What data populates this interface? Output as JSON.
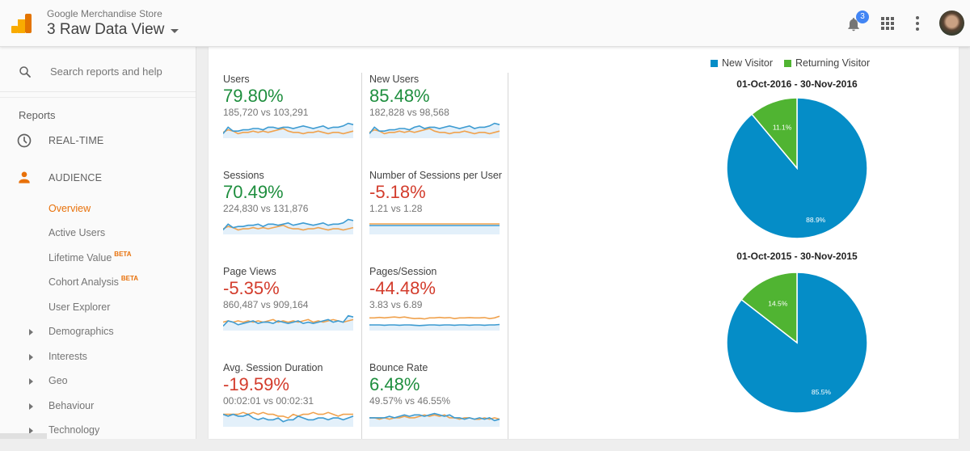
{
  "header": {
    "account": "Google Merchandise Store",
    "view": "3 Raw Data View",
    "notification_count": "3"
  },
  "sidebar": {
    "search_placeholder": "Search reports and help",
    "section_label": "Reports",
    "realtime": "REAL-TIME",
    "audience": "AUDIENCE",
    "items": [
      {
        "label": "Overview",
        "active": true
      },
      {
        "label": "Active Users"
      },
      {
        "label": "Lifetime Value",
        "badge": "BETA"
      },
      {
        "label": "Cohort Analysis",
        "badge": "BETA"
      },
      {
        "label": "User Explorer"
      },
      {
        "label": "Demographics",
        "expandable": true
      },
      {
        "label": "Interests",
        "expandable": true
      },
      {
        "label": "Geo",
        "expandable": true
      },
      {
        "label": "Behaviour",
        "expandable": true
      },
      {
        "label": "Technology",
        "expandable": true
      }
    ]
  },
  "colors": {
    "current": "#3d9bd1",
    "previous": "#f0a24e",
    "positive": "#1e8e3e",
    "negative": "#d33c2c",
    "new_visitor": "#058dc7",
    "returning_visitor": "#50b432",
    "accent": "#e8710a"
  },
  "metrics": [
    {
      "title": "Users",
      "change": "79.80%",
      "direction": "up",
      "comparison": "185,720 vs 103,291",
      "current": [
        4,
        9,
        6,
        6,
        7,
        7,
        8,
        8,
        7,
        9,
        9,
        8,
        9,
        9,
        8,
        9,
        10,
        9,
        8,
        9,
        10,
        8,
        9,
        9,
        10,
        12,
        11
      ],
      "previous": [
        5,
        7,
        6,
        4,
        5,
        5,
        6,
        5,
        6,
        5,
        6,
        7,
        8,
        6,
        5,
        5,
        4,
        5,
        5,
        6,
        5,
        4,
        5,
        5,
        4,
        5,
        6
      ]
    },
    {
      "title": "New Users",
      "change": "85.48%",
      "direction": "up",
      "comparison": "182,828 vs 98,568",
      "current": [
        4,
        9,
        6,
        6,
        7,
        7,
        8,
        8,
        7,
        9,
        10,
        8,
        9,
        9,
        8,
        9,
        10,
        9,
        8,
        9,
        10,
        8,
        9,
        9,
        10,
        12,
        11
      ],
      "previous": [
        5,
        7,
        6,
        4,
        5,
        5,
        6,
        5,
        6,
        5,
        6,
        7,
        8,
        6,
        5,
        5,
        4,
        5,
        5,
        6,
        5,
        4,
        5,
        5,
        4,
        5,
        6
      ]
    },
    {
      "title": "Sessions",
      "change": "70.49%",
      "direction": "up",
      "comparison": "224,830 vs 131,876",
      "current": [
        4,
        9,
        6,
        7,
        7,
        8,
        8,
        9,
        7,
        9,
        9,
        8,
        9,
        10,
        8,
        9,
        10,
        9,
        8,
        9,
        10,
        8,
        9,
        9,
        10,
        13,
        12
      ],
      "previous": [
        5,
        7,
        6,
        4,
        5,
        5,
        6,
        5,
        6,
        5,
        6,
        7,
        8,
        6,
        5,
        5,
        4,
        5,
        5,
        6,
        5,
        4,
        5,
        5,
        4,
        5,
        6
      ]
    },
    {
      "title": "Number of Sessions per User",
      "change": "-5.18%",
      "direction": "down",
      "comparison": "1.21 vs 1.28",
      "current": [
        10,
        10,
        10,
        10,
        10,
        10,
        10,
        10,
        10,
        10,
        10,
        10,
        10,
        10,
        10,
        10,
        10,
        10,
        10,
        10,
        10,
        10,
        10,
        10,
        10,
        10,
        10
      ],
      "previous": [
        10.3,
        10.3,
        10.3,
        10.3,
        10.3,
        10.3,
        10.3,
        10.3,
        10.3,
        10.3,
        10.3,
        10.3,
        10.3,
        10.3,
        10.3,
        10.3,
        10.3,
        10.3,
        10.3,
        10.3,
        10.3,
        10.3,
        10.3,
        10.3,
        10.3,
        10.3,
        10.3
      ]
    },
    {
      "title": "Page Views",
      "change": "-5.35%",
      "direction": "down",
      "comparison": "860,487 vs 909,164",
      "current": [
        4,
        8,
        7,
        5,
        6,
        7,
        8,
        6,
        7,
        7,
        6,
        8,
        7,
        6,
        7,
        8,
        6,
        7,
        6,
        7,
        8,
        9,
        7,
        8,
        7,
        12,
        11
      ],
      "previous": [
        7,
        8,
        7,
        8,
        7,
        8,
        7,
        8,
        7,
        8,
        9,
        7,
        8,
        7,
        8,
        7,
        8,
        9,
        7,
        8,
        7,
        8,
        9,
        8,
        7,
        8,
        9
      ]
    },
    {
      "title": "Pages/Session",
      "change": "-44.48%",
      "direction": "down",
      "comparison": "3.83 vs 6.89",
      "current": [
        5,
        5,
        5,
        4.8,
        5,
        5,
        4.8,
        5,
        5,
        4.8,
        4.6,
        4.8,
        5,
        5,
        4.8,
        5,
        5,
        4.8,
        5,
        5,
        4.8,
        5,
        5,
        4.8,
        5,
        5,
        5.2
      ],
      "previous": [
        9,
        9,
        9.3,
        9,
        9.3,
        9.5,
        9.2,
        9.5,
        9,
        8.6,
        8.8,
        8.4,
        9,
        9,
        9.3,
        9,
        9.2,
        8.6,
        9,
        9,
        9.2,
        9,
        9,
        9.2,
        8.6,
        9,
        10
      ]
    },
    {
      "title": "Avg. Session Duration",
      "change": "-19.59%",
      "direction": "down",
      "comparison": "00:02:01 vs 00:02:31",
      "current": [
        8,
        7,
        8,
        7,
        7,
        8,
        6,
        5,
        6,
        5,
        5,
        6,
        4,
        5,
        5,
        7,
        6,
        5,
        5,
        6,
        6,
        5,
        6,
        6,
        5,
        6,
        7
      ],
      "previous": [
        8,
        8,
        8,
        8,
        9,
        8,
        9,
        8,
        9,
        8,
        8,
        7,
        7,
        6,
        8,
        7,
        8,
        8,
        9,
        8,
        8,
        9,
        8,
        7,
        8,
        8,
        8
      ]
    },
    {
      "title": "Bounce Rate",
      "change": "6.48%",
      "direction": "up",
      "comparison": "49.57% vs 46.55%",
      "current": [
        8,
        8,
        8,
        8,
        8.5,
        8,
        8.5,
        9,
        8.5,
        9,
        9,
        8.5,
        9,
        9.5,
        9,
        8.5,
        9,
        8,
        8,
        7.5,
        8,
        7.5,
        8,
        7.5,
        8,
        7,
        7.5
      ],
      "previous": [
        8,
        8,
        7.5,
        8,
        7.5,
        8,
        8,
        8.5,
        8,
        8,
        8.5,
        9,
        8.5,
        9,
        8.5,
        9,
        8,
        8,
        7.5,
        8,
        8,
        7.5,
        7.5,
        8,
        7.5,
        8,
        7.5
      ]
    }
  ],
  "chart_data": [
    {
      "type": "pie",
      "title": "01-Oct-2016 - 30-Nov-2016",
      "legend": [
        "New Visitor",
        "Returning Visitor"
      ],
      "legend_position": "top",
      "slices": [
        {
          "label": "New Visitor",
          "value": 88.9,
          "display": "88.9%"
        },
        {
          "label": "Returning Visitor",
          "value": 11.1,
          "display": "11.1%"
        }
      ]
    },
    {
      "type": "pie",
      "title": "01-Oct-2015 - 30-Nov-2015",
      "legend": [
        "New Visitor",
        "Returning Visitor"
      ],
      "legend_position": "top",
      "slices": [
        {
          "label": "New Visitor",
          "value": 85.5,
          "display": "85.5%"
        },
        {
          "label": "Returning Visitor",
          "value": 14.5,
          "display": "14.5%"
        }
      ]
    }
  ]
}
